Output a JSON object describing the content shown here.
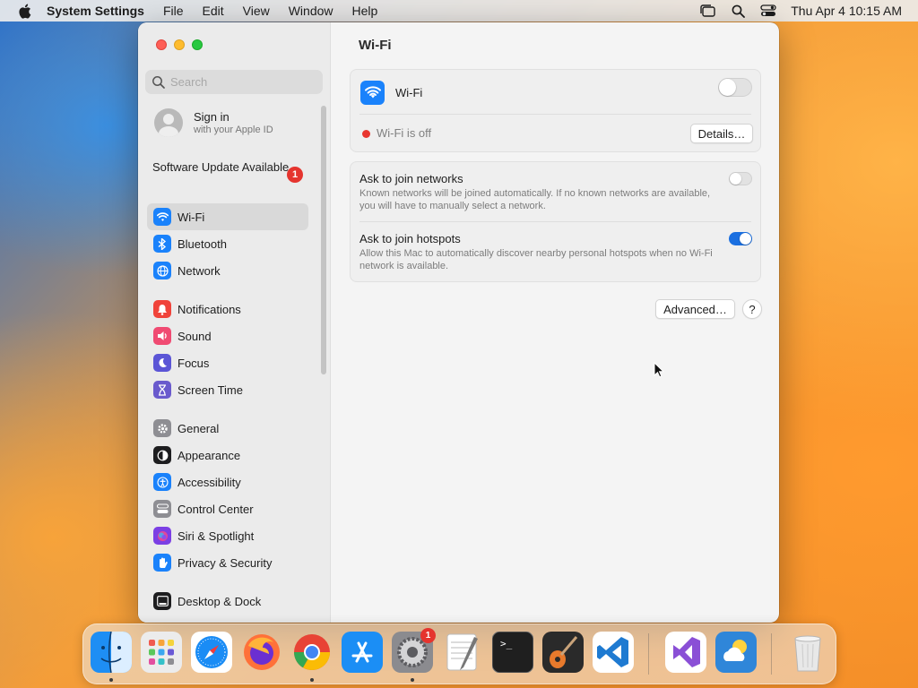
{
  "menubar": {
    "app_name": "System Settings",
    "menus": [
      "File",
      "Edit",
      "View",
      "Window",
      "Help"
    ],
    "clock": "Thu Apr 4  10:15 AM"
  },
  "sidebar": {
    "search_placeholder": "Search",
    "account": {
      "title": "Sign in",
      "subtitle": "with your Apple ID"
    },
    "software_update": {
      "label": "Software Update Available",
      "badge": "1"
    },
    "groups": [
      [
        {
          "label": "Wi-Fi",
          "icon": "wifi-icon",
          "color": "#1a82fb",
          "active": true
        },
        {
          "label": "Bluetooth",
          "icon": "bluetooth-icon",
          "color": "#1a82fb"
        },
        {
          "label": "Network",
          "icon": "globe-icon",
          "color": "#1a82fb"
        }
      ],
      [
        {
          "label": "Notifications",
          "icon": "bell-icon",
          "color": "#f0433a"
        },
        {
          "label": "Sound",
          "icon": "speaker-icon",
          "color": "#f04a72"
        },
        {
          "label": "Focus",
          "icon": "moon-icon",
          "color": "#5b55d6"
        },
        {
          "label": "Screen Time",
          "icon": "hourglass-icon",
          "color": "#6a5acd"
        }
      ],
      [
        {
          "label": "General",
          "icon": "gear-icon",
          "color": "#8e8e93"
        },
        {
          "label": "Appearance",
          "icon": "appearance-icon",
          "color": "#1d1d1f"
        },
        {
          "label": "Accessibility",
          "icon": "accessibility-icon",
          "color": "#1a82fb"
        },
        {
          "label": "Control Center",
          "icon": "control-center-icon",
          "color": "#8e8e93"
        },
        {
          "label": "Siri & Spotlight",
          "icon": "siri-icon",
          "color": "#7b3fe4"
        },
        {
          "label": "Privacy & Security",
          "icon": "hand-icon",
          "color": "#1a82fb"
        }
      ],
      [
        {
          "label": "Desktop & Dock",
          "icon": "dock-icon",
          "color": "#1d1d1f"
        }
      ]
    ]
  },
  "main": {
    "title": "Wi-Fi",
    "wifi_row": {
      "label": "Wi-Fi",
      "enabled": false
    },
    "status": {
      "text": "Wi-Fi is off",
      "color": "#e8362f"
    },
    "details_button": "Details…",
    "ask_networks": {
      "title": "Ask to join networks",
      "description": "Known networks will be joined automatically. If no known networks are available, you will have to manually select a network.",
      "enabled": false
    },
    "ask_hotspots": {
      "title": "Ask to join hotspots",
      "description": "Allow this Mac to automatically discover nearby personal hotspots when no Wi-Fi network is available.",
      "enabled": true
    },
    "advanced_button": "Advanced…",
    "help_button": "?"
  },
  "dock": {
    "apps": [
      {
        "name": "Finder",
        "icon": "finder-icon",
        "running": true
      },
      {
        "name": "Launchpad",
        "icon": "launchpad-icon",
        "running": false
      },
      {
        "name": "Safari",
        "icon": "safari-icon",
        "running": false
      },
      {
        "name": "Firefox",
        "icon": "firefox-icon",
        "running": false
      },
      {
        "name": "Chrome",
        "icon": "chrome-icon",
        "running": true
      },
      {
        "name": "App Store",
        "icon": "app-store-icon",
        "running": false
      },
      {
        "name": "System Settings",
        "icon": "system-settings-icon",
        "running": true,
        "badge": "1"
      },
      {
        "name": "TextEdit",
        "icon": "textedit-icon",
        "running": false
      },
      {
        "name": "Terminal",
        "icon": "terminal-icon",
        "running": false
      },
      {
        "name": "GarageBand",
        "icon": "garageband-icon",
        "running": false
      },
      {
        "name": "Visual Studio Code",
        "icon": "vscode-icon",
        "running": false
      },
      {
        "name": "Visual Studio",
        "icon": "visual-studio-icon",
        "running": false
      },
      {
        "name": "Weather",
        "icon": "weather-icon",
        "running": false
      },
      {
        "name": "Trash",
        "icon": "trash-icon",
        "running": false
      }
    ],
    "terminal_prompt": ">_"
  }
}
